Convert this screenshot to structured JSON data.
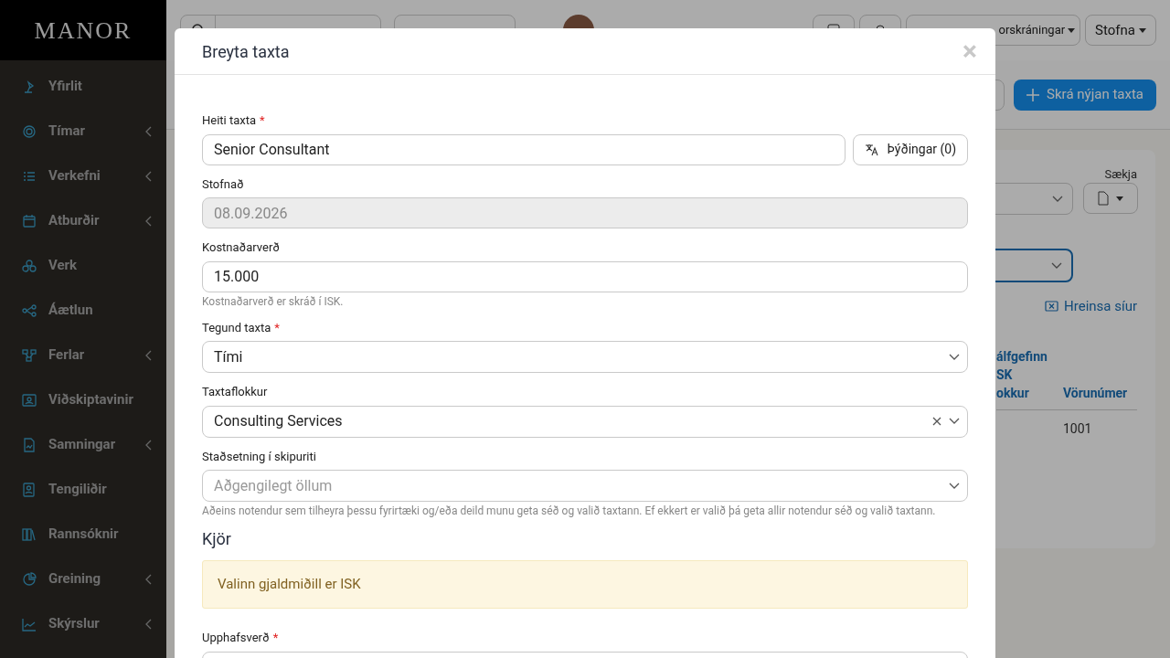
{
  "sidebar": {
    "logo": "MANOR",
    "items": [
      {
        "label": "Yfirlit",
        "expandable": false
      },
      {
        "label": "Tímar",
        "expandable": true
      },
      {
        "label": "Verkefni",
        "expandable": true
      },
      {
        "label": "Atburðir",
        "expandable": true
      },
      {
        "label": "Verk",
        "expandable": false
      },
      {
        "label": "Áætlun",
        "expandable": false
      },
      {
        "label": "Ferlar",
        "expandable": true
      },
      {
        "label": "Viðskiptavinir",
        "expandable": false
      },
      {
        "label": "Samningar",
        "expandable": true
      },
      {
        "label": "Tengiliðir",
        "expandable": false
      },
      {
        "label": "Rannsóknir",
        "expandable": false
      },
      {
        "label": "Greining",
        "expandable": true
      },
      {
        "label": "Skýrslur",
        "expandable": true
      }
    ]
  },
  "header": {
    "favorites": "orskráningar",
    "create": "Stofna"
  },
  "toolbar": {
    "new_button": "Skrá nýjan taxta"
  },
  "panel": {
    "export_label": "Sækja",
    "clear_filters": "Hreinsa síur",
    "columns": [
      "álfgefinn\nSK\nokkur",
      "Vörunúmer"
    ],
    "rows": [
      [
        "",
        "1001"
      ]
    ]
  },
  "modal": {
    "title": "Breyta taxta",
    "close": "×",
    "fields": [
      {
        "kind": "text",
        "label": "Heiti taxta",
        "marker": "*",
        "value": "Senior Consultant",
        "button": "Þýðingar (0)"
      },
      {
        "kind": "disabled",
        "label": "Stofnað",
        "value": "08.09.2026"
      },
      {
        "kind": "text",
        "label": "Kostnaðarverð",
        "value": "15.000",
        "help": "Kostnaðarverð er skráð í ISK."
      },
      {
        "kind": "select",
        "label": "Tegund taxta",
        "marker": "*",
        "value": "Tími",
        "clearable": false
      },
      {
        "kind": "select",
        "label": "Taxtaflokkur",
        "value": "Consulting Services",
        "clearable": true
      },
      {
        "kind": "select",
        "label": "Staðsetning í skipuriti",
        "placeholder": "Aðgengilegt öllum",
        "clearable": false,
        "help": "Aðeins notendur sem tilheyra þessu fyrirtæki og/eða deild munu geta séð og valið taxtann. Ef ekkert er valið þá geta allir notendur séð og valið taxtann."
      },
      {
        "kind": "heading",
        "label": "Kjör"
      },
      {
        "kind": "alert",
        "label": "Valinn gjaldmiðill er ISK"
      },
      {
        "kind": "text",
        "label": "Upphafsverð",
        "marker": "*"
      }
    ]
  }
}
